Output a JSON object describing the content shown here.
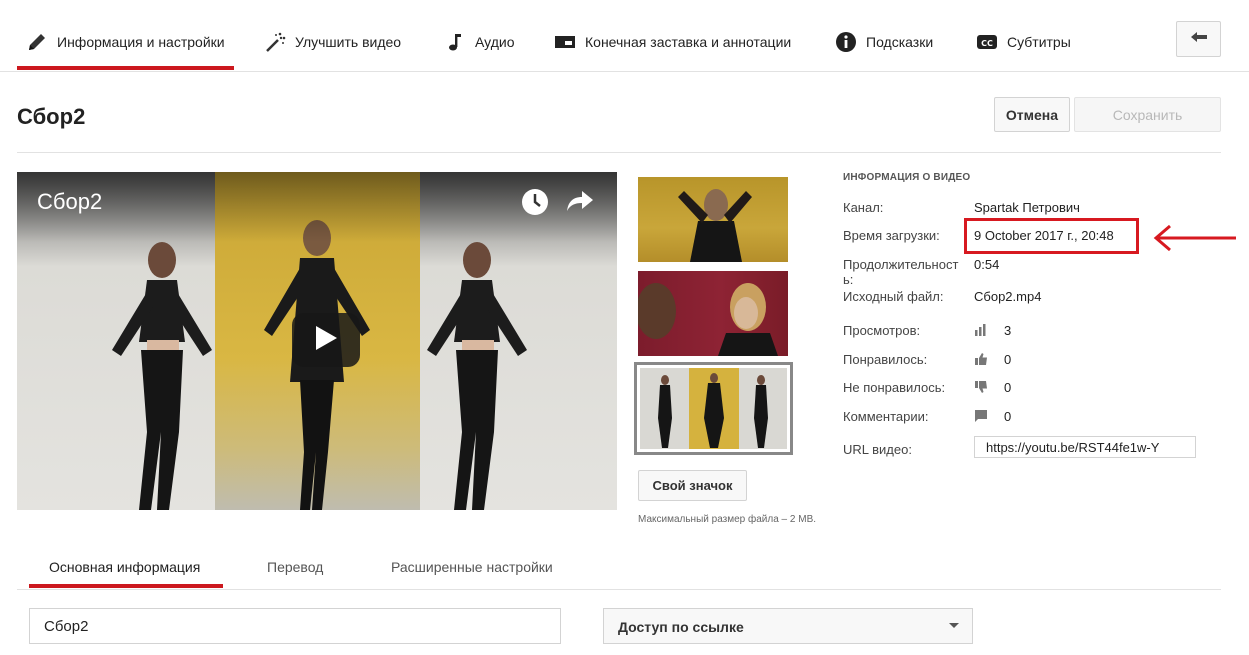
{
  "top_tabs": [
    {
      "label": "Информация и настройки",
      "icon": "pencil-icon",
      "active": true
    },
    {
      "label": "Улучшить видео",
      "icon": "magic-wand-icon"
    },
    {
      "label": "Аудио",
      "icon": "music-note-icon"
    },
    {
      "label": "Конечная заставка и аннотации",
      "icon": "end-screen-icon"
    },
    {
      "label": "Подсказки",
      "icon": "info-icon"
    },
    {
      "label": "Субтитры",
      "icon": "cc-icon"
    }
  ],
  "back_button": {
    "icon": "back-arrow-icon"
  },
  "page": {
    "title": "Сбор2",
    "cancel_label": "Отмена",
    "save_label": "Сохранить"
  },
  "player": {
    "title": "Сбор2",
    "icons": [
      "watch-later-icon",
      "share-icon",
      "play-icon"
    ]
  },
  "thumbnails": {
    "custom_button_label": "Свой значок",
    "note": "Максимальный размер файла – 2 MB.",
    "selected_index": 2
  },
  "info": {
    "heading": "ИНФОРМАЦИЯ О ВИДЕО",
    "channel_label": "Канал:",
    "channel_value": "Spartak Петрович",
    "upload_label": "Время загрузки:",
    "upload_value": "9 October 2017 г., 20:48",
    "duration_label": "Продолжительност\nь:",
    "duration_value": "0:54",
    "file_label": "Исходный файл:",
    "file_value": "Сбор2.mp4",
    "views_label": "Просмотров:",
    "views_value": "3",
    "likes_label": "Понравилось:",
    "likes_value": "0",
    "dislikes_label": "Не понравилось:",
    "dislikes_value": "0",
    "comments_label": "Комментарии:",
    "comments_value": "0",
    "url_label": "URL видео:",
    "url_value": "https://youtu.be/RST44fe1w-Y"
  },
  "annotation": {
    "color": "#d71920"
  },
  "bottom_tabs": [
    {
      "label": "Основная информация",
      "active": true
    },
    {
      "label": "Перевод"
    },
    {
      "label": "Расширенные настройки"
    }
  ],
  "form": {
    "title_value": "Сбор2",
    "access_value": "Доступ по ссылке"
  },
  "colors": {
    "accent": "#cc181e"
  }
}
